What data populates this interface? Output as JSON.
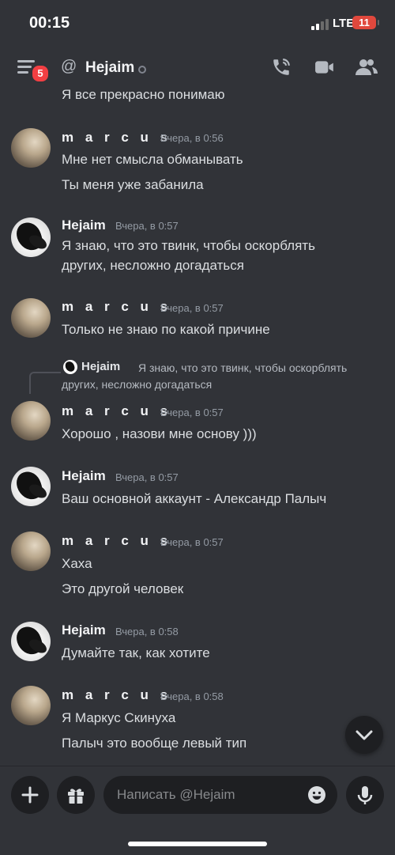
{
  "status_bar": {
    "time": "00:15",
    "network": "LTE",
    "battery": "11"
  },
  "header": {
    "notifications_badge": "5",
    "at_symbol": "@",
    "channel_name": "Hejaim"
  },
  "messages": [
    {
      "text": "Я все прекрасно понимаю"
    },
    {
      "author": "m a r c u s",
      "time": "Вчера, в 0:56",
      "lines": [
        "Мне нет смысла обманывать",
        "Ты меня уже забанила"
      ]
    },
    {
      "author": "Hejaim",
      "time": "Вчера, в 0:57",
      "lines": [
        "Я знаю, что это твинк, чтобы оскорблять",
        "других, несложно догадаться"
      ]
    },
    {
      "author": "m a r c u s",
      "time": "Вчера, в 0:57",
      "lines": [
        "Только не знаю по какой причине"
      ]
    },
    {
      "reply": {
        "author": "Hejaim",
        "text": "Я знаю, что это твинк, чтобы оскорблять других, несложно догадаться"
      },
      "author": "m a r c u s",
      "time": "Вчера, в 0:57",
      "lines": [
        "Хорошо , назови мне основу )))"
      ]
    },
    {
      "author": "Hejaim",
      "time": "Вчера, в 0:57",
      "lines": [
        "Ваш основной аккаунт - Александр Палыч"
      ]
    },
    {
      "author": "m a r c u s",
      "time": "Вчера, в 0:57",
      "lines": [
        "Хаха",
        "Это другой человек"
      ]
    },
    {
      "author": "Hejaim",
      "time": "Вчера, в 0:58",
      "lines": [
        "Думайте так, как хотите"
      ]
    },
    {
      "author": "m a r c u s",
      "time": "Вчера, в 0:58",
      "lines": [
        "Я Маркус Скинуха",
        "Палыч это вообще левый тип"
      ]
    }
  ],
  "composer": {
    "placeholder": "Написать @Hejaim"
  },
  "icons": {
    "menu": "hamburger-icon",
    "call": "phone-call-icon",
    "video": "video-camera-icon",
    "members": "members-icon",
    "plus": "plus-icon",
    "gift": "gift-icon",
    "emoji": "emoji-icon",
    "mic": "microphone-icon",
    "scroll": "chevron-down-icon"
  }
}
